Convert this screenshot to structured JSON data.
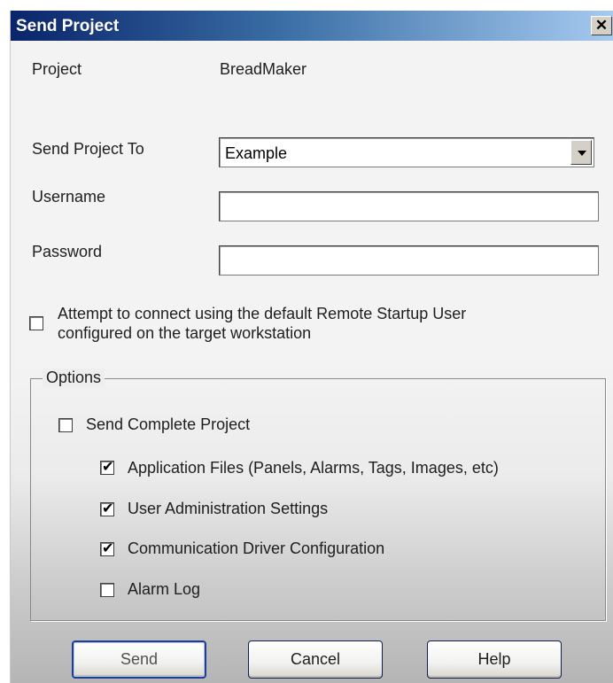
{
  "dialog": {
    "title": "Send Project",
    "close_glyph": "✕"
  },
  "form": {
    "project_label": "Project",
    "project_value": "BreadMaker",
    "send_to_label": "Send Project To",
    "send_to_value": "Example",
    "username_label": "Username",
    "username_value": "",
    "password_label": "Password",
    "password_value": ""
  },
  "default_user_checkbox": {
    "line1": "Attempt to connect using the default Remote Startup User",
    "line2": "configured on the target workstation",
    "checked": false
  },
  "options": {
    "legend": "Options",
    "send_complete": {
      "label": "Send Complete Project",
      "checked": false
    },
    "items": [
      {
        "label": "Application Files (Panels, Alarms, Tags, Images, etc)",
        "checked": true
      },
      {
        "label": "User Administration Settings",
        "checked": true
      },
      {
        "label": "Communication Driver Configuration",
        "checked": true
      },
      {
        "label": "Alarm Log",
        "checked": false
      }
    ]
  },
  "buttons": {
    "send": "Send",
    "cancel": "Cancel",
    "help": "Help"
  },
  "icons": {
    "check_glyph": "✔",
    "dropdown": "chevron-down-icon",
    "close": "close-icon"
  }
}
